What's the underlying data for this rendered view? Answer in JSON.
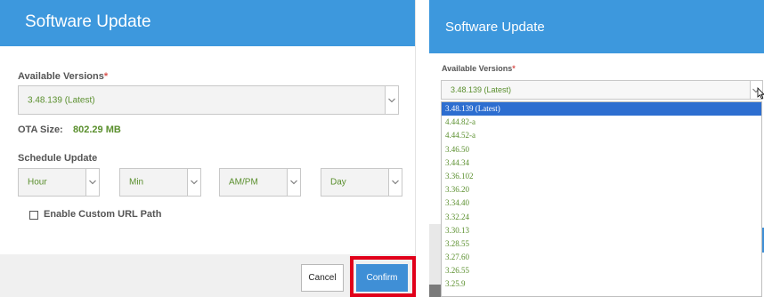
{
  "left": {
    "title": "Software Update",
    "available_versions_label": "Available Versions",
    "required_mark": "*",
    "selected_version": "3.48.139 (Latest)",
    "ota_size_label": "OTA Size:",
    "ota_size_value": "802.29 MB",
    "schedule_label": "Schedule Update",
    "schedule": {
      "hour": "Hour",
      "min": "Min",
      "ampm": "AM/PM",
      "day": "Day"
    },
    "custom_url_label": "Enable Custom URL Path",
    "cancel_label": "Cancel",
    "confirm_label": "Confirm"
  },
  "right": {
    "title": "Software Update",
    "available_versions_label": "Available Versions",
    "required_mark": "*",
    "selected_version": "3.48.139 (Latest)",
    "options": [
      "3.48.139 (Latest)",
      "4.44.82-a",
      "4.44.52-a",
      "3.46.50",
      "3.44.34",
      "3.36.102",
      "3.36.20",
      "3.34.40",
      "3.32.24",
      "3.30.13",
      "3.28.55",
      "3.27.60",
      "3.26.55",
      "3.25.9"
    ]
  },
  "colors": {
    "header_blue": "#3d98dd",
    "value_green": "#5a8f2d",
    "highlight_blue": "#2d6ed0",
    "confirm_blue": "#3f8fd6",
    "focus_red": "#e1001a"
  },
  "icons": [
    "chevron-down-icon",
    "checkbox-icon",
    "mouse-cursor-icon"
  ]
}
